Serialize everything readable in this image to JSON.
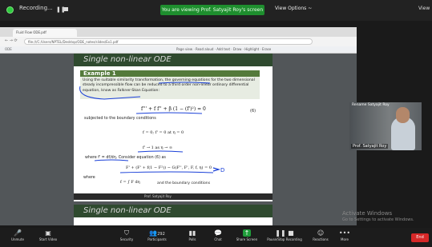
{
  "topbar": {
    "recording_label": "Recording...",
    "viewing_banner": "You are viewing Prof. Satyajit Roy's screen",
    "view_options": "View Options ~",
    "view_label": "View"
  },
  "browser": {
    "tab_title": "Fluid Flow ODE.pdf",
    "address": "file:///C:/Users/NPTEL/Desktop/ODE_notes/slides/Ex1.pdf",
    "pdf_label": "ODE",
    "pdf_tools": "Page view · Read aloud · Add text · Draw · Highlight · Erase"
  },
  "slide1": {
    "title": "Single non-linear ODE",
    "example_title": "Example 1",
    "example_text": "Using the suitable similarity transformation, the governing equations for the two dimensional steady incompressible flow can be reduced to a third order non-linear ordinary differential equation, know as Falkner-Skan Equation:",
    "equation1": "f''' + f f'' + β (1 − (f')²) = 0",
    "equation1_number": "(6)",
    "boundary_text": "subjected to the boundary conditions",
    "equation2": "f = 0; f' = 0    at    η = 0",
    "equation3": "f' → 1    as    η → ∞",
    "where1": "where f' = df/dη. Consider equation (6) as",
    "equation4": "F' + (F' + f(1 − F²)) − G(F'', F', F, f, η) = 0",
    "where2": "where",
    "equation5": "f = ∫ F dη",
    "equation5_tail": "and the boundary conditions",
    "footer": "Prof. Satyajit Roy"
  },
  "slide2": {
    "title": "Single non-linear ODE"
  },
  "video": {
    "name": "Prof. Satyajit Roy",
    "name_top": "Rename Satyajit Roy"
  },
  "watermark": {
    "line1": "Activate Windows",
    "line2": "Go to Settings to activate Windows."
  },
  "toolbar": {
    "unmute": "Unmute",
    "start_video": "Start Video",
    "security": "Security",
    "participants": "Participants",
    "participants_count": "292",
    "polls": "Polls",
    "chat": "Chat",
    "share_screen": "Share Screen",
    "pause_recording": "Pause/Stop Recording",
    "reactions": "Reactions",
    "more": "More",
    "end": "End"
  },
  "colors": {
    "zoom_green": "#1e8e2e",
    "slide_header": "#2f4a2f",
    "example_header": "#547a3b",
    "ink_blue": "#1a40d8",
    "end_red": "#d62828"
  }
}
